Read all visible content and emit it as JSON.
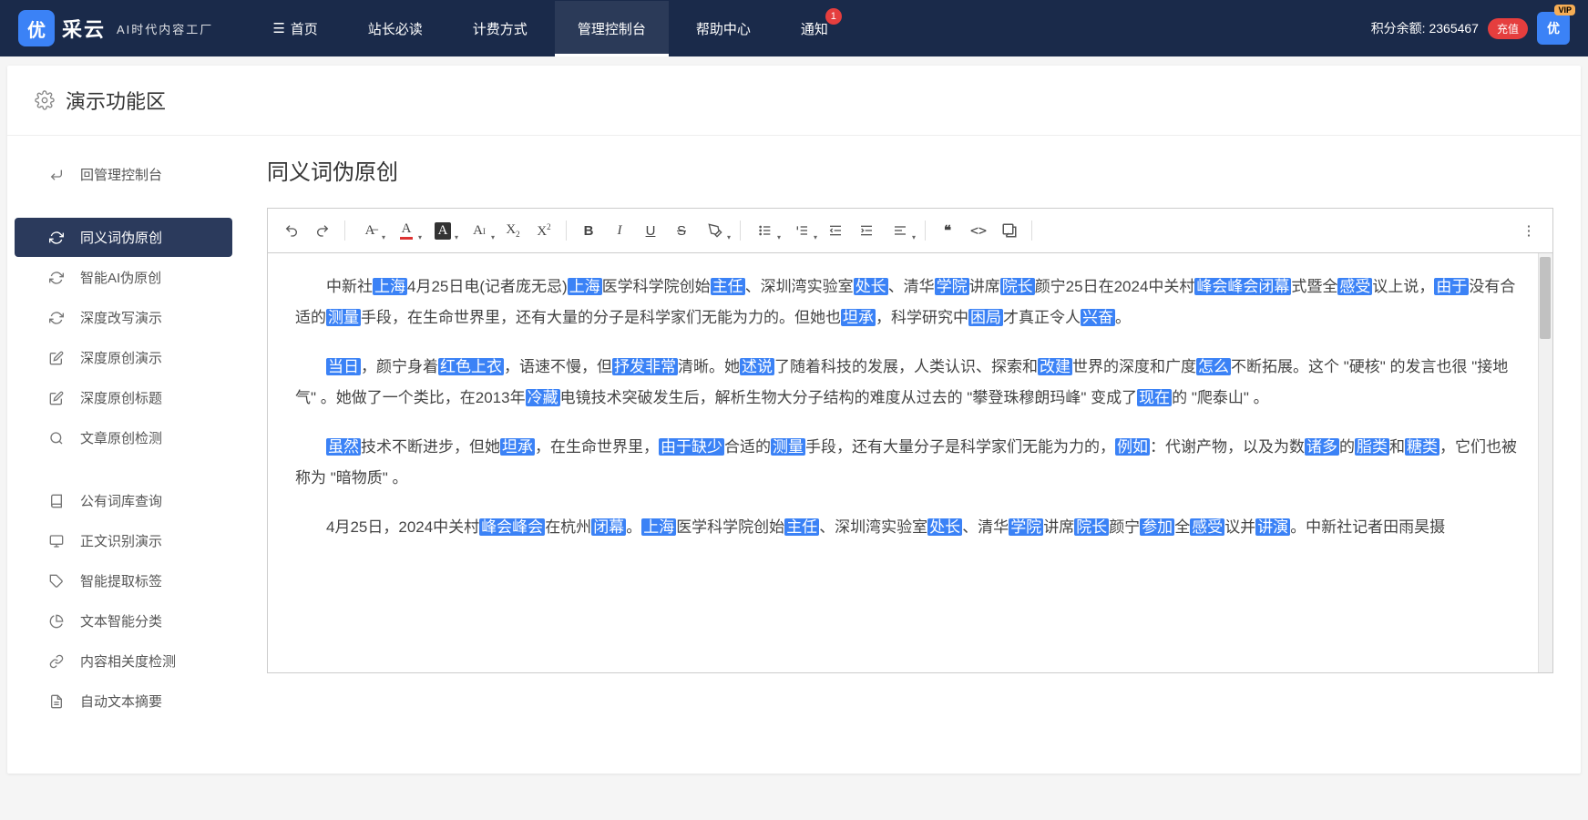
{
  "header": {
    "logo_char": "优",
    "logo_title": "采云",
    "logo_sub": "AI时代内容工厂",
    "nav": [
      {
        "label": "首页",
        "icon": true
      },
      {
        "label": "站长必读"
      },
      {
        "label": "计费方式"
      },
      {
        "label": "管理控制台",
        "active": true
      },
      {
        "label": "帮助中心"
      },
      {
        "label": "通知",
        "badge": "1"
      }
    ],
    "points_label": "积分余额:",
    "points_value": "2365467",
    "recharge": "充值",
    "vip": "VIP",
    "avatar_char": "优"
  },
  "page_title": "演示功能区",
  "sidebar": {
    "groups": [
      [
        {
          "icon": "reply",
          "label": "回管理控制台"
        }
      ],
      [
        {
          "icon": "refresh",
          "label": "同义词伪原创",
          "active": true
        },
        {
          "icon": "refresh",
          "label": "智能AI伪原创"
        },
        {
          "icon": "refresh",
          "label": "深度改写演示"
        },
        {
          "icon": "edit",
          "label": "深度原创演示"
        },
        {
          "icon": "edit",
          "label": "深度原创标题"
        },
        {
          "icon": "search",
          "label": "文章原创检测"
        }
      ],
      [
        {
          "icon": "book",
          "label": "公有词库查询"
        },
        {
          "icon": "monitor",
          "label": "正文识别演示"
        },
        {
          "icon": "tag",
          "label": "智能提取标签"
        },
        {
          "icon": "pie",
          "label": "文本智能分类"
        },
        {
          "icon": "link",
          "label": "内容相关度检测"
        },
        {
          "icon": "doc",
          "label": "自动文本摘要"
        }
      ]
    ]
  },
  "content": {
    "title": "同义词伪原创",
    "paragraphs": [
      {
        "segments": [
          {
            "t": "中新社"
          },
          {
            "t": "上海",
            "h": true
          },
          {
            "t": "4月25日电(记者庞无忌)"
          },
          {
            "t": "上海",
            "h": true
          },
          {
            "t": "医学科学院创始"
          },
          {
            "t": "主任",
            "h": true
          },
          {
            "t": "、深圳湾实验室"
          },
          {
            "t": "处长",
            "h": true
          },
          {
            "t": "、清华"
          },
          {
            "t": "学院",
            "h": true
          },
          {
            "t": "讲席"
          },
          {
            "t": "院长",
            "h": true
          },
          {
            "t": "颜宁25日在2024中关村"
          },
          {
            "t": "峰会峰会闭幕",
            "h": true
          },
          {
            "t": "式暨全"
          },
          {
            "t": "感受",
            "h": true
          },
          {
            "t": "议上说，"
          },
          {
            "t": "由于",
            "h": true
          },
          {
            "t": "没有合适的"
          },
          {
            "t": "测量",
            "h": true
          },
          {
            "t": "手段，在生命世界里，还有大量的分子是科学家们无能为力的。但她也"
          },
          {
            "t": "坦承",
            "h": true
          },
          {
            "t": "，科学研究中"
          },
          {
            "t": "困局",
            "h": true
          },
          {
            "t": "才真正令人"
          },
          {
            "t": "兴奋",
            "h": true
          },
          {
            "t": "。"
          }
        ]
      },
      {
        "segments": [
          {
            "t": "当日",
            "h": true
          },
          {
            "t": "，颜宁身着"
          },
          {
            "t": "红色上衣",
            "h": true
          },
          {
            "t": "，语速不慢，但"
          },
          {
            "t": "抒发非常",
            "h": true
          },
          {
            "t": "清晰。她"
          },
          {
            "t": "述说",
            "h": true
          },
          {
            "t": "了随着科技的发展，人类认识、探索和"
          },
          {
            "t": "改建",
            "h": true
          },
          {
            "t": "世界的深度和广度"
          },
          {
            "t": "怎么",
            "h": true
          },
          {
            "t": "不断拓展。这个 \"硬核\" 的发言也很 \"接地气\" 。她做了一个类比，在2013年"
          },
          {
            "t": "冷藏",
            "h": true
          },
          {
            "t": "电镜技术突破发生后，解析生物大分子结构的难度从过去的 \"攀登珠穆朗玛峰\" 变成了"
          },
          {
            "t": "现在",
            "h": true
          },
          {
            "t": "的 \"爬泰山\" 。"
          }
        ]
      },
      {
        "segments": [
          {
            "t": "虽然",
            "h": true
          },
          {
            "t": "技术不断进步，但她"
          },
          {
            "t": "坦承",
            "h": true
          },
          {
            "t": "，在生命世界里，"
          },
          {
            "t": "由于缺少",
            "h": true
          },
          {
            "t": "合适的"
          },
          {
            "t": "测量",
            "h": true
          },
          {
            "t": "手段，还有大量分子是科学家们无能为力的，"
          },
          {
            "t": "例如",
            "h": true
          },
          {
            "t": "：代谢产物，以及为数"
          },
          {
            "t": "诸多",
            "h": true
          },
          {
            "t": "的"
          },
          {
            "t": "脂类",
            "h": true
          },
          {
            "t": "和"
          },
          {
            "t": "糖类",
            "h": true
          },
          {
            "t": "，它们也被称为 \"暗物质\" 。"
          }
        ]
      },
      {
        "segments": [
          {
            "t": "4月25日，2024中关村"
          },
          {
            "t": "峰会峰会",
            "h": true
          },
          {
            "t": "在杭州"
          },
          {
            "t": "闭幕",
            "h": true
          },
          {
            "t": "。"
          },
          {
            "t": "上海",
            "h": true
          },
          {
            "t": "医学科学院创始"
          },
          {
            "t": "主任",
            "h": true
          },
          {
            "t": "、深圳湾实验室"
          },
          {
            "t": "处长",
            "h": true
          },
          {
            "t": "、清华"
          },
          {
            "t": "学院",
            "h": true
          },
          {
            "t": "讲席"
          },
          {
            "t": "院长",
            "h": true
          },
          {
            "t": "颜宁"
          },
          {
            "t": "参加",
            "h": true
          },
          {
            "t": "全"
          },
          {
            "t": "感受",
            "h": true
          },
          {
            "t": "议并"
          },
          {
            "t": "讲演",
            "h": true
          },
          {
            "t": "。中新社记者田雨昊摄"
          }
        ]
      }
    ]
  }
}
